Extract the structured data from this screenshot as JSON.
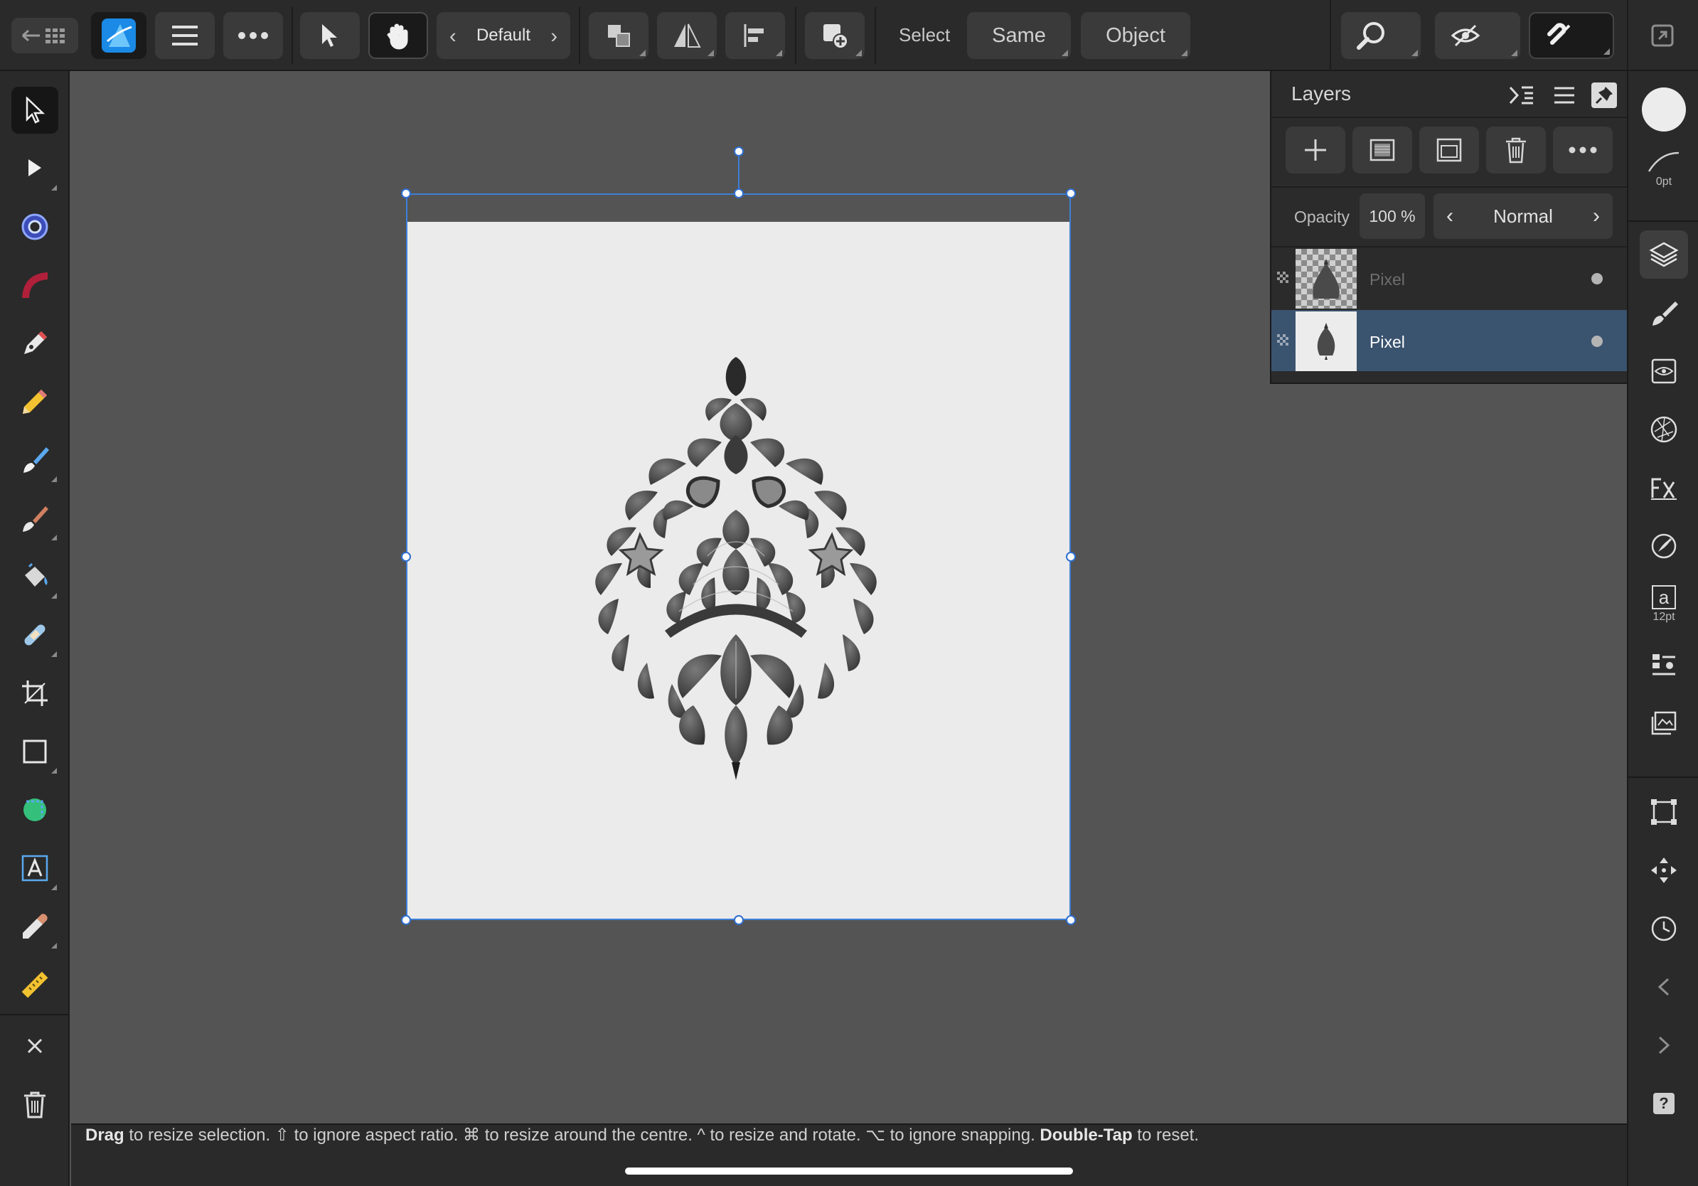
{
  "toolbar": {
    "persona_default": "Default",
    "select_label": "Select",
    "same_label": "Same",
    "object_label": "Object"
  },
  "layers_panel": {
    "title": "Layers",
    "opacity_label": "Opacity",
    "opacity_value": "100 %",
    "blend_mode": "Normal",
    "layers": [
      {
        "name": "Pixel",
        "selected": false,
        "dimmed": true
      },
      {
        "name": "Pixel",
        "selected": true,
        "dimmed": false
      }
    ]
  },
  "studio": {
    "stroke_width": "0pt",
    "text_size": "12pt",
    "text_glyph": "a",
    "help_glyph": "?"
  },
  "status": {
    "hint_part1_bold": "Drag",
    "hint_part1": " to resize selection. ⇧ to ignore aspect ratio. ⌘ to resize around the centre. ^ to resize and rotate. ⌥ to ignore snapping. ",
    "hint_part2_bold": "Double-Tap",
    "hint_part2": " to reset."
  },
  "colors": {
    "accent": "#3f7fd6",
    "selected_layer": "#3a536f",
    "app_icon": "#1e8fe8"
  }
}
